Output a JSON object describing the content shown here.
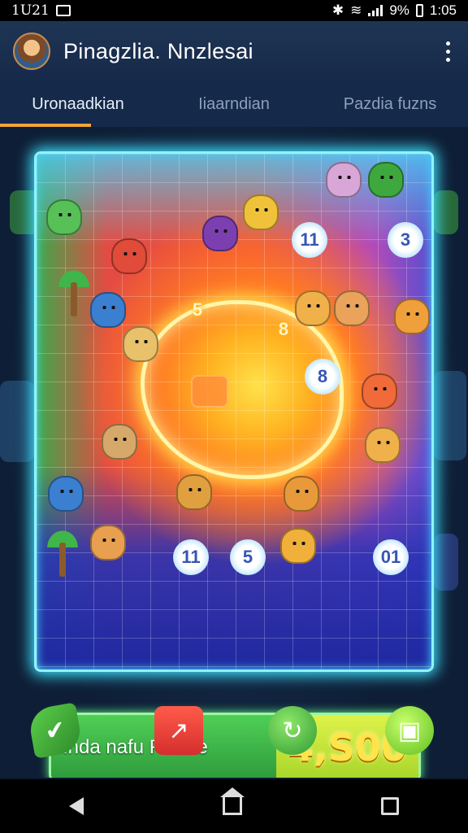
{
  "status_bar": {
    "time_left": "1U21",
    "battery_pct": "9%",
    "time_right": "1:05"
  },
  "app_bar": {
    "title": "Pinagzlia. Nnzlesai",
    "menu_icon": "kebab-menu-icon"
  },
  "tabs": [
    {
      "label": "Uronaadkian",
      "active": true
    },
    {
      "label": "Iiaarndian",
      "active": false
    },
    {
      "label": "Pazdia fuzns",
      "active": false
    }
  ],
  "board": {
    "numbers": [
      "5",
      "11",
      "3",
      "8",
      "5",
      "11",
      "5",
      "01",
      "8"
    ],
    "colors": {
      "frame": "#8ff3ff",
      "glow": "#ffd54a"
    }
  },
  "banner": {
    "label": "Ihda nafu Puzzle",
    "score": "4,S00"
  },
  "actions": [
    {
      "icon": "leaf-icon"
    },
    {
      "icon": "share-icon"
    },
    {
      "icon": "refresh-icon"
    },
    {
      "icon": "camera-icon"
    }
  ],
  "nav": {
    "back": "back-icon",
    "home": "home-icon",
    "recents": "recents-icon"
  }
}
